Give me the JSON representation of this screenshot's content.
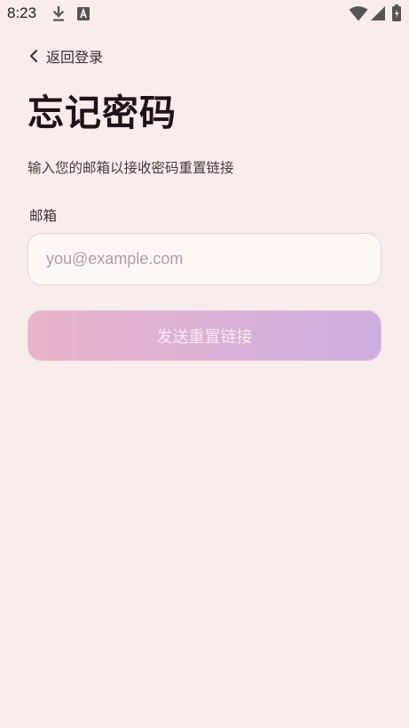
{
  "status_bar": {
    "time": "8:23",
    "icons": [
      "download-icon",
      "font-badge-icon",
      "wifi-icon",
      "signal-icon",
      "battery-icon"
    ]
  },
  "nav": {
    "back_label": "返回登录",
    "back_icon": "chevron-left-icon"
  },
  "page": {
    "title": "忘记密码",
    "subtitle": "输入您的邮箱以接收密码重置链接"
  },
  "form": {
    "email_label": "邮箱",
    "email_value": "",
    "email_placeholder": "you@example.com",
    "submit_label": "发送重置链接"
  },
  "colors": {
    "background": "#f9ecec",
    "button_gradient_start": "#e9b5c9",
    "button_gradient_end": "#cdaee0",
    "title": "#1f1219"
  }
}
